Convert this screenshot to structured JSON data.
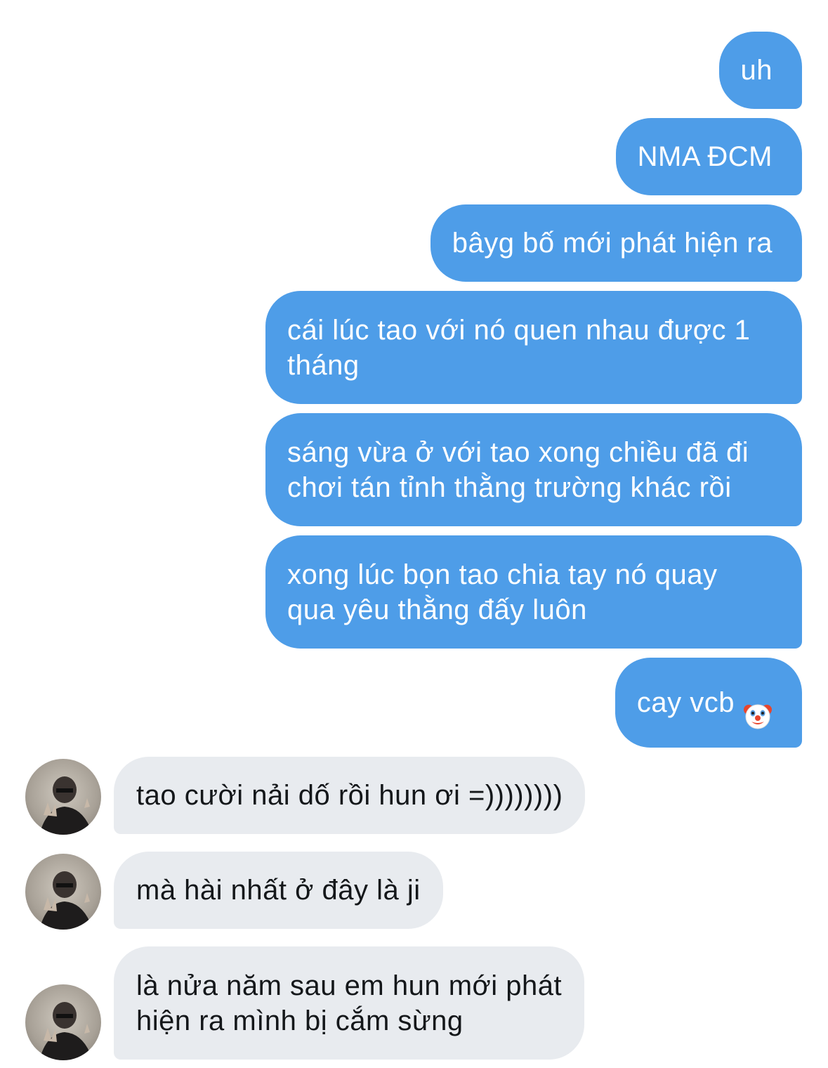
{
  "colors": {
    "outgoing_bubble": "#4e9de8",
    "incoming_bubble": "#e8ebef",
    "outgoing_text": "#ffffff",
    "incoming_text": "#14171a"
  },
  "outgoing": [
    {
      "text": "uh"
    },
    {
      "text": "NMA ĐCM"
    },
    {
      "text": "bâyg bố mới phát hiện ra"
    },
    {
      "text": "cái lúc tao với nó quen nhau được 1\ntháng"
    },
    {
      "text": "sáng vừa ở với tao xong chiều đã đi\nchơi tán tỉnh thằng trường khác rồi"
    },
    {
      "text": "xong lúc bọn tao chia tay nó quay\nqua yêu thằng đấy luôn"
    },
    {
      "text": "cay vcb",
      "emoji": "clown-face-icon"
    }
  ],
  "incoming": [
    {
      "text": "tao cười nải dố rồi hun ơi =))))))))",
      "avatar": "user-avatar"
    },
    {
      "text": "mà hài nhất ở đây là ji",
      "avatar": "user-avatar"
    },
    {
      "text": "là nửa năm sau em hun mới phát\nhiện ra mình bị cắm sừng",
      "avatar": "user-avatar"
    }
  ]
}
